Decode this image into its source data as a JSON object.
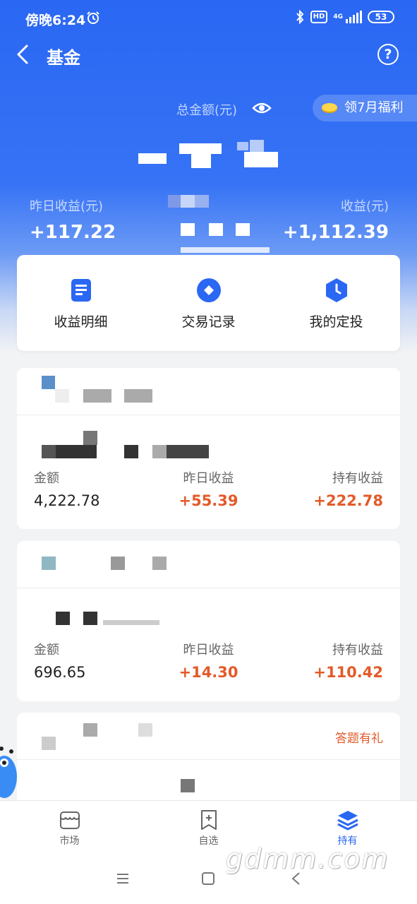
{
  "status_bar": {
    "time": "傍晚6:24",
    "network": "4G",
    "hd": "HD",
    "battery": "53"
  },
  "nav": {
    "title": "基金",
    "help_icon": "question-circle-icon",
    "help_label": "?"
  },
  "summary": {
    "total_label": "总金额(元)",
    "welfare_label": "领7月福利",
    "yesterday_label": "昨日收益(元)",
    "yesterday_value": "+117.22",
    "holding_label_visible": "收益(元)",
    "holding_value": "+1,112.39"
  },
  "quick_actions": [
    {
      "label": "收益明细",
      "icon": "document-icon"
    },
    {
      "label": "交易记录",
      "icon": "diamond-circle-icon"
    },
    {
      "label": "我的定投",
      "icon": "clock-hexagon-icon"
    }
  ],
  "funds": [
    {
      "amount_label": "金额",
      "amount": "4,222.78",
      "yesterday_label": "昨日收益",
      "yesterday": "+55.39",
      "holding_label": "持有收益",
      "holding": "+222.78"
    },
    {
      "amount_label": "金额",
      "amount": "696.65",
      "yesterday_label": "昨日收益",
      "yesterday": "+14.30",
      "holding_label": "持有收益",
      "holding": "+110.42"
    },
    {
      "quiz_label": "答题有礼"
    }
  ],
  "tabs": [
    {
      "label": "市场",
      "icon": "store-icon",
      "active": false
    },
    {
      "label": "自选",
      "icon": "bookmark-plus-icon",
      "active": false
    },
    {
      "label": "持有",
      "icon": "layers-icon",
      "active": true
    }
  ],
  "watermark": "gdmm.com",
  "colors": {
    "primary": "#2a67f3",
    "profit": "#e35a2a",
    "background": "#f2f3f5"
  }
}
